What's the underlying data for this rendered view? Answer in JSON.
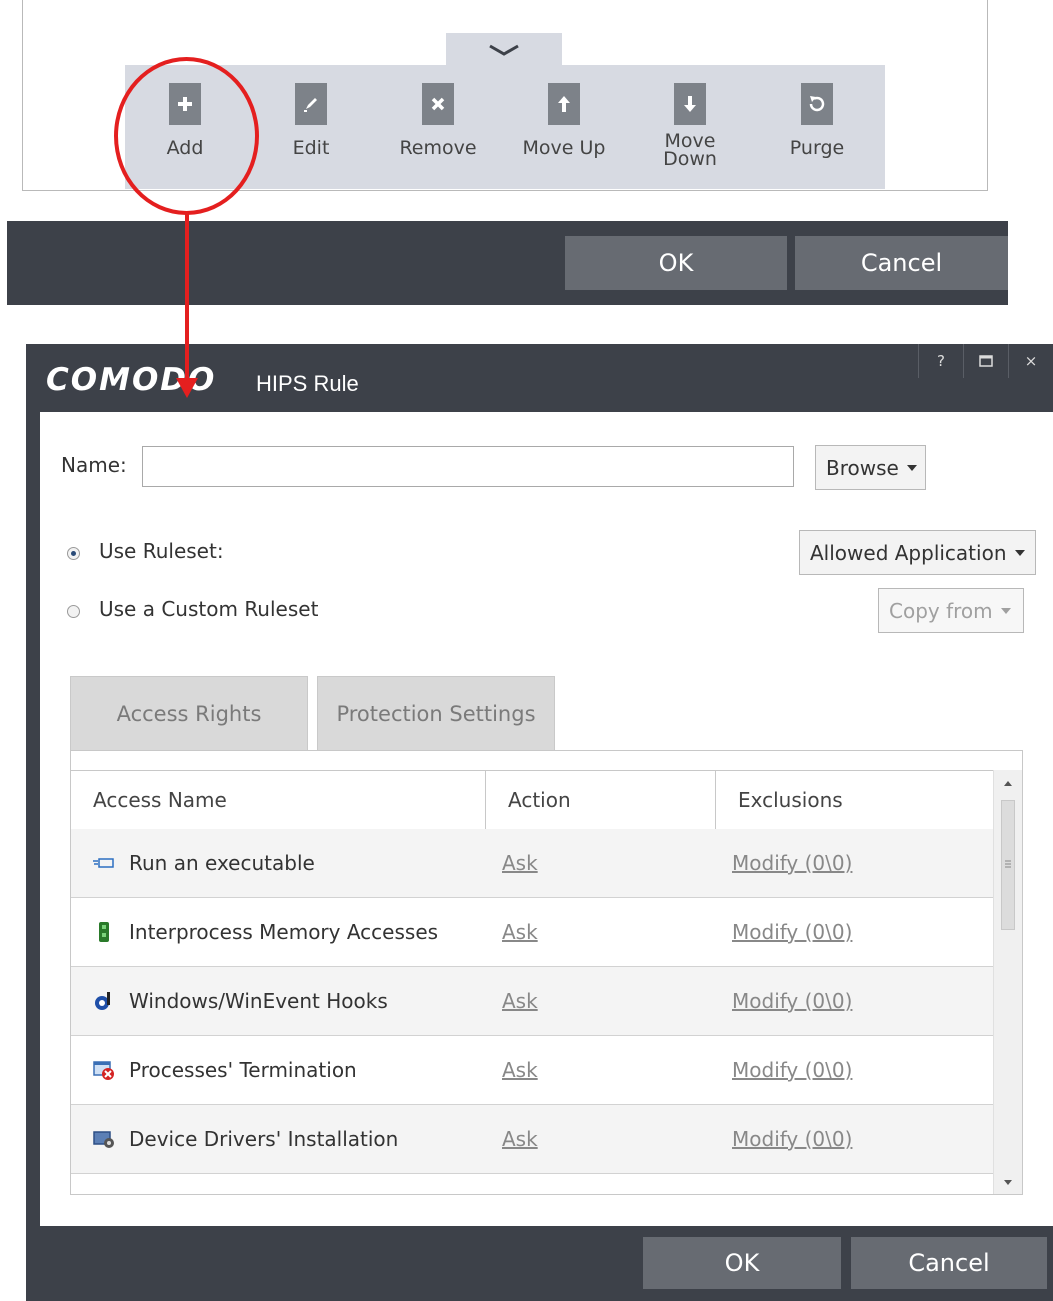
{
  "toolbar": {
    "items": [
      {
        "label": "Add",
        "icon": "plus-icon"
      },
      {
        "label": "Edit",
        "icon": "pencil-icon"
      },
      {
        "label": "Remove",
        "icon": "close-icon"
      },
      {
        "label": "Move Up",
        "icon": "arrow-up-icon"
      },
      {
        "label_line1": "Move",
        "label_line2": "Down",
        "icon": "arrow-down-icon"
      },
      {
        "label": "Purge",
        "icon": "refresh-icon"
      }
    ]
  },
  "top_footer": {
    "ok": "OK",
    "cancel": "Cancel"
  },
  "dialog": {
    "brand": "COMODO",
    "title": "HIPS Rule",
    "window_buttons": {
      "help": "?",
      "close": "×"
    },
    "name_label": "Name:",
    "name_value": "",
    "browse": "Browse",
    "use_ruleset": "Use Ruleset:",
    "use_custom_ruleset": "Use a Custom Ruleset",
    "ruleset_selected": "Allowed Application",
    "copy_from": "Copy from",
    "tabs": [
      "Access Rights",
      "Protection Settings"
    ],
    "columns": [
      "Access Name",
      "Action",
      "Exclusions"
    ],
    "rows": [
      {
        "name": "Run an executable",
        "action": "Ask",
        "exclusions": "Modify (0\\0)",
        "icon": "executable-icon"
      },
      {
        "name": "Interprocess Memory Accesses",
        "action": "Ask",
        "exclusions": "Modify (0\\0)",
        "icon": "memory-icon"
      },
      {
        "name": "Windows/WinEvent Hooks",
        "action": "Ask",
        "exclusions": "Modify (0\\0)",
        "icon": "hook-icon"
      },
      {
        "name": "Processes' Termination",
        "action": "Ask",
        "exclusions": "Modify (0\\0)",
        "icon": "terminate-icon"
      },
      {
        "name": "Device Drivers' Installation",
        "action": "Ask",
        "exclusions": "Modify (0\\0)",
        "icon": "driver-icon"
      }
    ],
    "footer": {
      "ok": "OK",
      "cancel": "Cancel"
    }
  },
  "colors": {
    "annotation": "#e41f1f",
    "dark_bar": "#3d4149",
    "button": "#676b72"
  }
}
